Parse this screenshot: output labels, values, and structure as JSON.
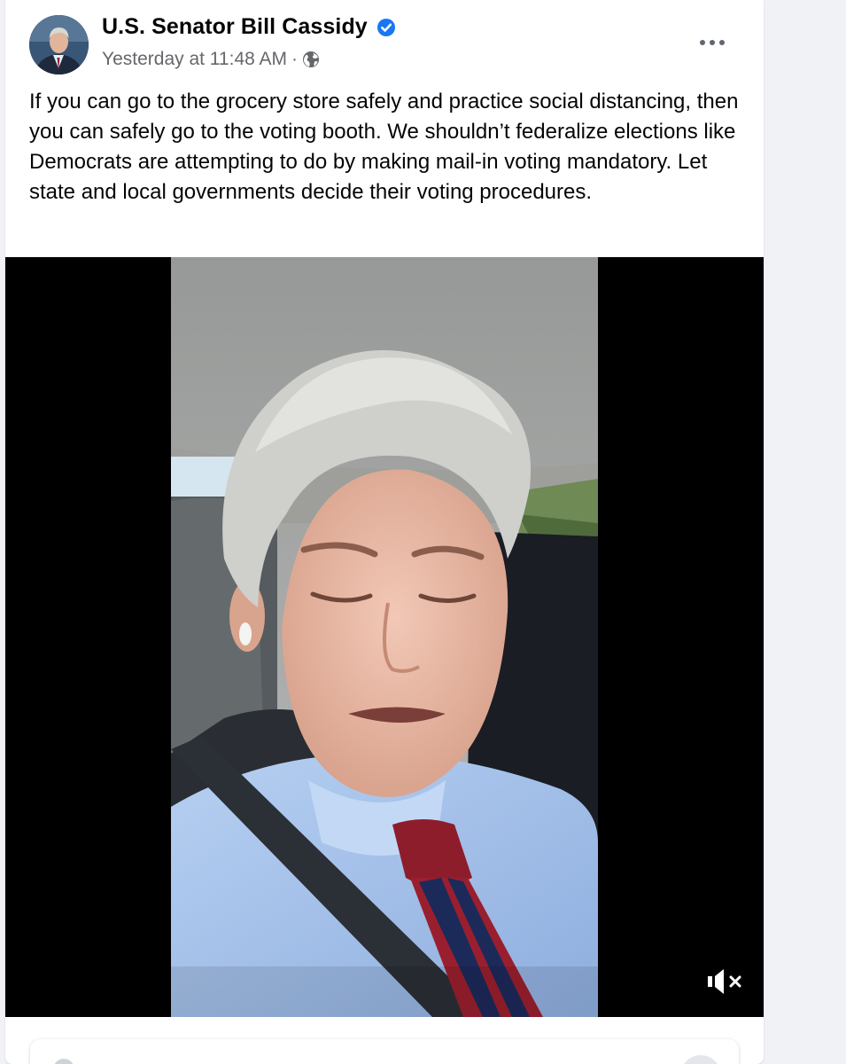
{
  "post": {
    "author": "U.S. Senator Bill Cassidy",
    "timestamp": "Yesterday at 11:48 AM",
    "separator": "·",
    "audience_icon": "globe-icon",
    "verified_icon": "verified-badge-icon",
    "more_icon": "more-options-icon",
    "text": "If you can go to the grocery store safely and practice social distancing, then you can safely go to the voting booth. We shouldn’t federalize elections like Democrats are attempting to do by making mail-in voting mandatory. Let state and local governments decide their voting procedures."
  },
  "video": {
    "muted": true,
    "mute_icon": "speaker-muted-icon"
  },
  "colors": {
    "verified_blue": "#1877f2",
    "tie_red": "#9a1f2e",
    "tie_navy": "#1c2a5a",
    "shirt_blue": "#a9c6ec"
  }
}
